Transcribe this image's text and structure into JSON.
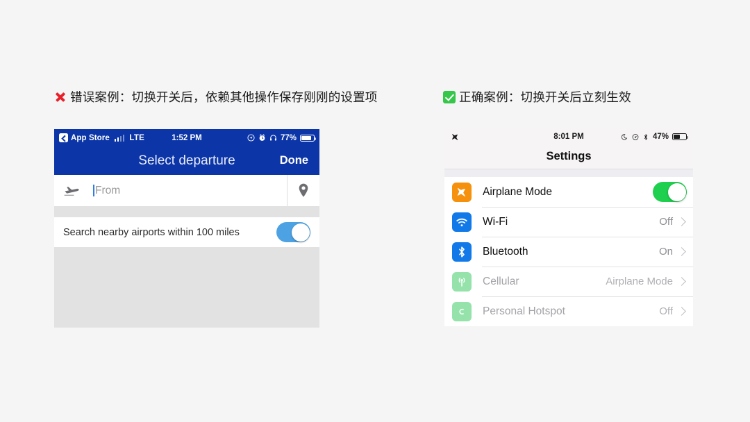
{
  "headings": {
    "bad": {
      "mark": "red-cross-icon",
      "text": "错误案例：切换开关后，依赖其他操作保存刚刚的设置项"
    },
    "good": {
      "mark": "green-check-icon",
      "text": "正确案例：切换开关后立刻生效"
    }
  },
  "bad_example": {
    "statusbar": {
      "back_label": "App Store",
      "carrier": "LTE",
      "time": "1:52 PM",
      "battery_percent": "77%",
      "icons": [
        "back-chevron-icon",
        "signal-bars-icon",
        "location-icon",
        "alarm-icon",
        "headphones-icon",
        "battery-icon"
      ]
    },
    "navbar": {
      "title": "Select departure",
      "done_label": "Done"
    },
    "field": {
      "leading_icon": "airplane-depart-icon",
      "placeholder": "From",
      "value": "",
      "trailing_icon": "map-pin-icon"
    },
    "toggle_row": {
      "label": "Search nearby airports within 100 miles",
      "state": "on",
      "color": "#4da2e3"
    }
  },
  "good_example": {
    "statusbar": {
      "airplane_icon": "airplane-icon",
      "time": "8:01 PM",
      "battery_percent": "47%",
      "icons": [
        "moon-icon",
        "location-icon",
        "bluetooth-icon",
        "battery-icon"
      ]
    },
    "title": "Settings",
    "rows": [
      {
        "icon": "airplane-icon",
        "icon_color": "#f5910c",
        "label": "Airplane Mode",
        "control": "switch",
        "state": "on",
        "switch_color": "#1ed04d",
        "dim": false
      },
      {
        "icon": "wifi-icon",
        "icon_color": "#127ae8",
        "label": "Wi-Fi",
        "control": "chevron",
        "value": "Off",
        "dim": false
      },
      {
        "icon": "bluetooth-icon",
        "icon_color": "#127ae8",
        "label": "Bluetooth",
        "control": "chevron",
        "value": "On",
        "dim": false
      },
      {
        "icon": "cellular-icon",
        "icon_color": "#95e3ab",
        "label": "Cellular",
        "control": "chevron",
        "value": "Airplane Mode",
        "dim": true
      },
      {
        "icon": "hotspot-icon",
        "icon_color": "#95e3ab",
        "label": "Personal Hotspot",
        "control": "chevron",
        "value": "Off",
        "dim": true
      }
    ]
  },
  "colors": {
    "page_background": "#f5f5f5",
    "nav_blue": "#0c36a8",
    "accent_blue": "#4da2e3",
    "accent_green": "#1ed04d",
    "error_red": "#e8202a",
    "success_green": "#34c749"
  }
}
